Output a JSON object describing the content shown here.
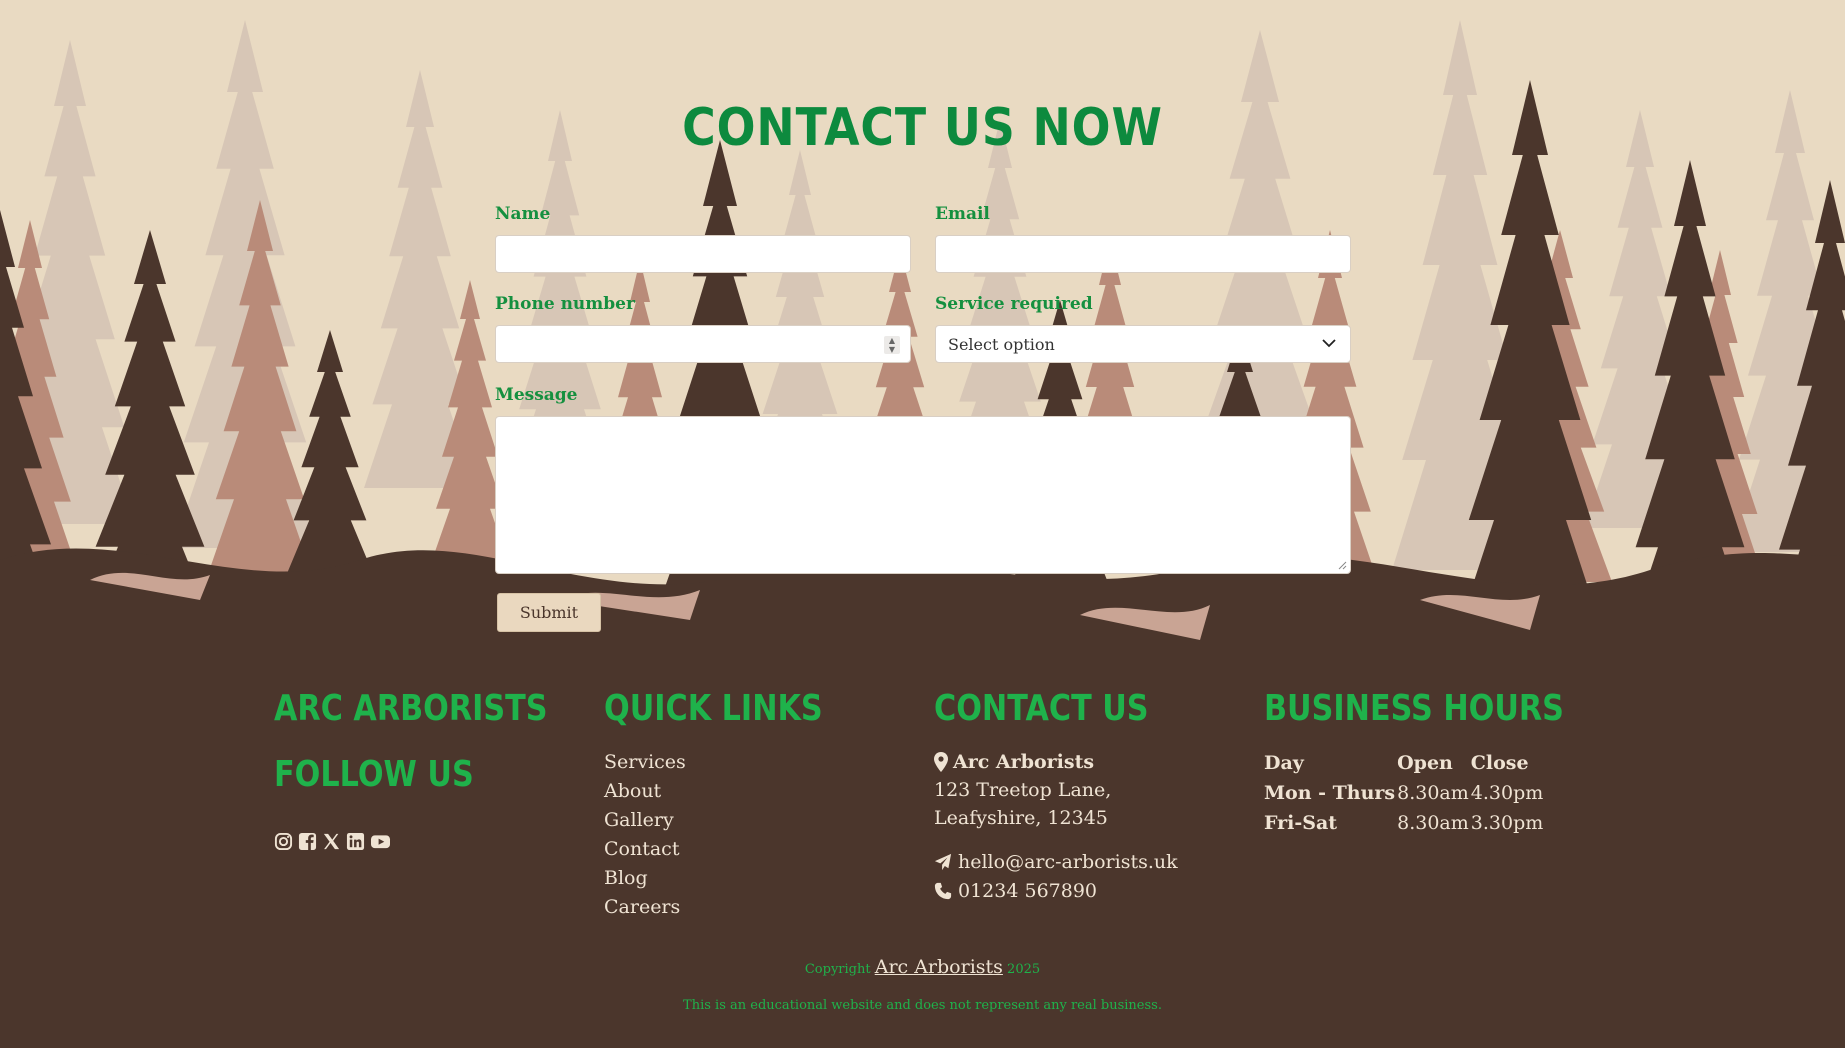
{
  "contact": {
    "title": "CONTACT US NOW",
    "name_label": "Name",
    "email_label": "Email",
    "phone_label": "Phone number",
    "service_label": "Service required",
    "service_value": "Select option",
    "message_label": "Message",
    "submit_label": "Submit"
  },
  "footer": {
    "brand_heading": "ARC ARBORISTS",
    "follow_heading": "FOLLOW US",
    "social_icons": [
      "instagram-icon",
      "facebook-icon",
      "x-icon",
      "linkedin-icon",
      "youtube-icon"
    ],
    "quick_links_heading": "QUICK LINKS",
    "quick_links": [
      "Services",
      "About",
      "Gallery",
      "Contact",
      "Blog",
      "Careers"
    ],
    "contact_heading": "CONTACT US",
    "address_name": "Arc Arborists",
    "address_line1": "123 Treetop Lane,",
    "address_line2": "Leafyshire, 12345",
    "email": "hello@arc-arborists.uk",
    "phone": "01234 567890",
    "hours_heading": "BUSINESS HOURS",
    "hours_headers": [
      "Day",
      "Open",
      "Close"
    ],
    "hours_rows": [
      [
        "Mon - Thurs",
        "8.30am",
        "4.30pm"
      ],
      [
        "Fri-Sat",
        "8.30am",
        "3.30pm"
      ]
    ],
    "copyright_prefix": "Copyright",
    "copyright_link": "Arc Arborists",
    "copyright_year": "2025",
    "disclaimer": "This is an educational website and does not represent any real business."
  },
  "colors": {
    "sky": "#e9dac2",
    "dark_brown": "#4b362c",
    "heading_green": "#0d8a3e",
    "footer_green": "#1fb24b",
    "tree_pale": "#d2bfad",
    "tree_mid": "#b9897a"
  }
}
